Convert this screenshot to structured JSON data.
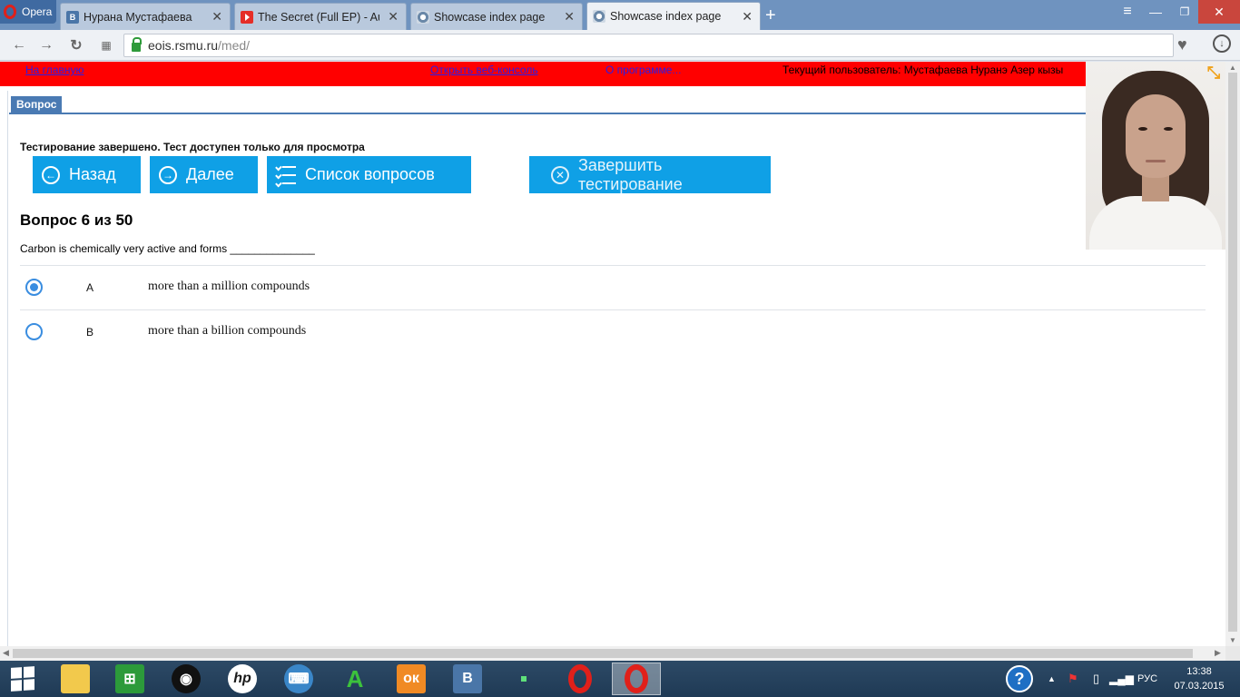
{
  "browser": {
    "menu_label": "Opera",
    "tabs": [
      {
        "icon": "vk-icon",
        "title": "Нурана Мустафаева"
      },
      {
        "icon": "youtube-icon",
        "title": "The Secret (Full EP) - Aust"
      },
      {
        "icon": "showcase-icon",
        "title": "Showcase index page"
      },
      {
        "icon": "showcase-icon",
        "title": "Showcase index page"
      }
    ],
    "url_host": "eois.rsmu.ru",
    "url_path": "/med/"
  },
  "topbar": {
    "home_link": "На главную",
    "console_link": "Открыть веб-консоль",
    "about_link": "О программе...",
    "current_user": "Текущий пользователь: Мустафаева Нуранэ Азер кызы"
  },
  "section_tab": "Вопрос",
  "status_text": "Тестирование завершено. Тест доступен только для просмотра",
  "buttons": {
    "back": "Назад",
    "next": "Далее",
    "question_list": "Список вопросов",
    "finish": "Завершить тестирование"
  },
  "question": {
    "heading": "Вопрос 6 из 50",
    "text": "Carbon is chemically very active and forms ______________",
    "options": [
      {
        "letter": "A",
        "text": "more than a million compounds",
        "selected": true
      },
      {
        "letter": "B",
        "text": "more than a billion compounds",
        "selected": false
      }
    ]
  },
  "taskbar": {
    "language": "РУС",
    "time": "13:38",
    "date": "07.03.2015"
  }
}
